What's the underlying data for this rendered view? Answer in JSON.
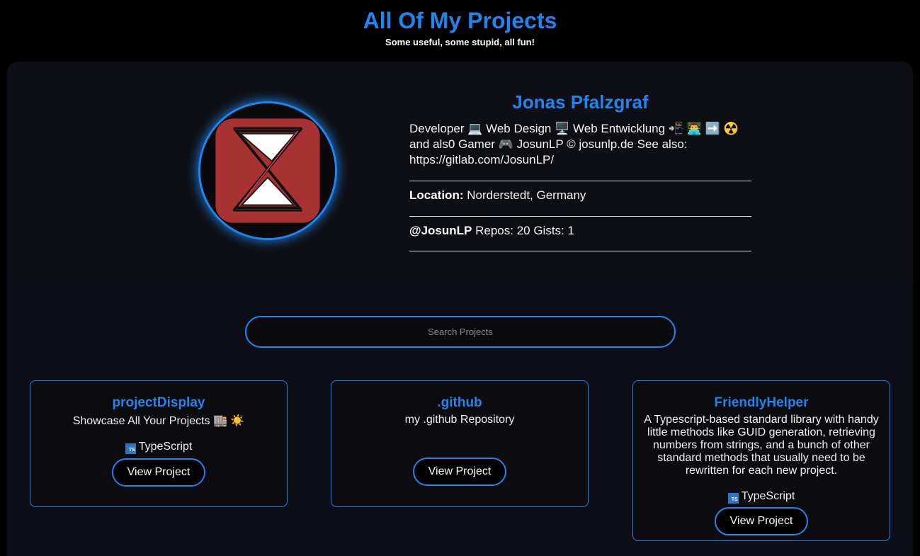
{
  "header": {
    "title": "All Of My Projects",
    "subtitle": "Some useful, some stupid, all fun!"
  },
  "profile": {
    "name": "Jonas Pfalzgraf",
    "bio": "Developer 💻 Web Design 🖥️ Web Entwicklung 📲 👨‍💻 ➡️ ☢️ and als0 Gamer 🎮 JosunLP © josunlp.de See also: https://gitlab.com/JosunLP/",
    "location_label": "Location:",
    "location": "Norderstedt, Germany",
    "handle": "@JosunLP",
    "stats": "Repos: 20 Gists: 1"
  },
  "search": {
    "placeholder": "Search Projects",
    "value": ""
  },
  "projects": [
    {
      "title": "projectDisplay",
      "description": "Showcase All Your Projects 🏬 ☀️",
      "language": "TypeScript",
      "button": "View Project"
    },
    {
      "title": ".github",
      "description": "my .github Repository",
      "language": "",
      "button": "View Project"
    },
    {
      "title": "FriendlyHelper",
      "description": "A Typescript-based standard library with handy little methods like GUID generation, retrieving numbers from strings, and a bunch of other standard methods that usually need to be rewritten for each new project.",
      "language": "TypeScript",
      "button": "View Project"
    }
  ],
  "language_icon": {
    "name": "typescript-icon",
    "text": "TS"
  },
  "colors": {
    "accent": "#1e86ee",
    "background": "#000000",
    "panel": "#0e0f14",
    "projects_bg": "#0b0e17",
    "logo_red": "#a83232"
  }
}
